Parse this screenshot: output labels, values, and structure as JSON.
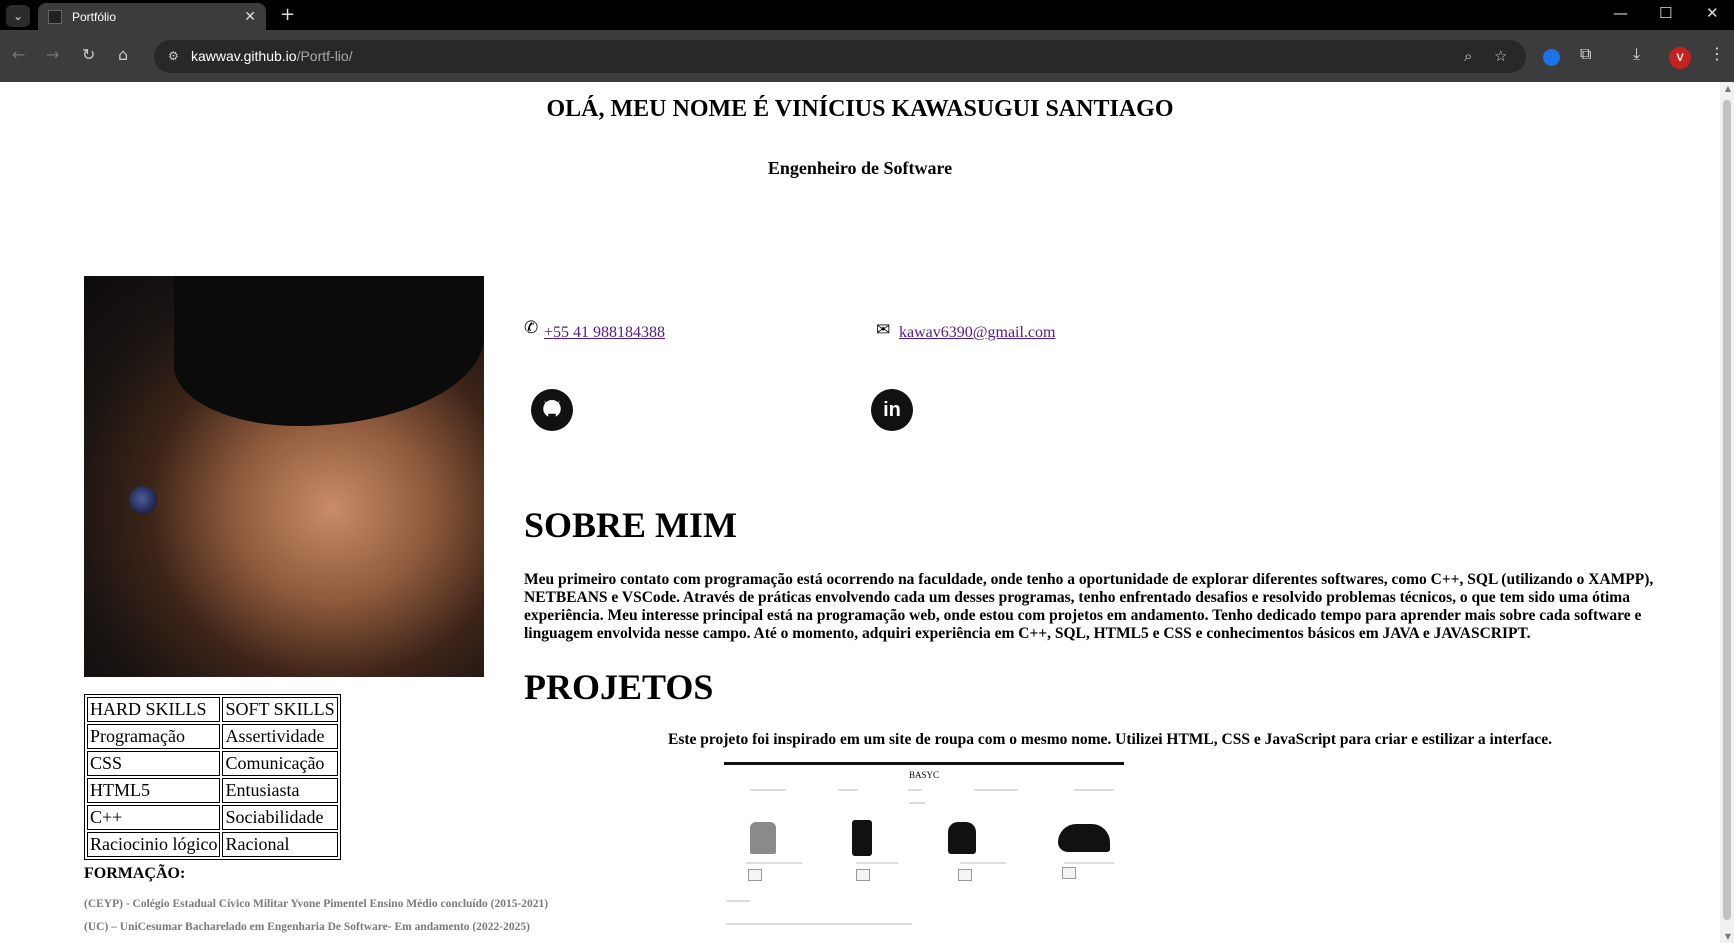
{
  "browser": {
    "tab_title": "Portfólio",
    "url_host": "kawwav.github.io",
    "url_path": "/Portf-lio/",
    "profile_initial": "V"
  },
  "header": {
    "name": "OLÁ, MEU NOME É VINÍCIUS KAWASUGUI SANTIAGO",
    "role": "Engenheiro de Software"
  },
  "contact": {
    "phone": "+55 41 988184388",
    "email": "kawav6390@gmail.com",
    "github_icon": "github-icon",
    "linkedin_icon": "linkedin-icon",
    "linkedin_glyph": "in"
  },
  "skills": {
    "headers": [
      "HARD SKILLS",
      "SOFT SKILLS"
    ],
    "rows": [
      [
        "Programação",
        "Assertividade"
      ],
      [
        "CSS",
        "Comunicação"
      ],
      [
        "HTML5",
        "Entusiasta"
      ],
      [
        "C++",
        "Sociabilidade"
      ],
      [
        "Raciocinio lógico",
        "Racional"
      ]
    ]
  },
  "formacao": {
    "title": "FORMAÇÃO:",
    "items": [
      "(CEYP) - Colégio Estadual Cívico Militar Yvone Pimentel Ensino Médio concluído (2015-2021)",
      "(UC) – UniCesumar Bacharelado em Engenharia De Software- Em andamento (2022-2025)"
    ]
  },
  "sobre": {
    "title": "SOBRE MIM",
    "text": "Meu primeiro contato com programação está ocorrendo na faculdade, onde tenho a oportunidade de explorar diferentes softwares, como C++, SQL (utilizando o XAMPP), NETBEANS e VSCode. Através de práticas envolvendo cada um desses programas, tenho enfrentado desafios e resolvido problemas técnicos, o que tem sido uma ótima experiência. Meu interesse principal está na programação web, onde estou com projetos em andamento. Tenho dedicado tempo para aprender mais sobre cada software e linguagem envolvida nesse campo. Até o momento, adquiri experiência em C++, SQL, HTML5 e CSS e conhecimentos básicos em JAVA e JAVASCRIPT."
  },
  "projetos": {
    "title": "PROJETOS",
    "description": "Este projeto foi inspirado em um site de roupa com o mesmo nome. Utilizei HTML, CSS e JavaScript para criar e estilizar a interface.",
    "preview_brand": "BASYC"
  }
}
